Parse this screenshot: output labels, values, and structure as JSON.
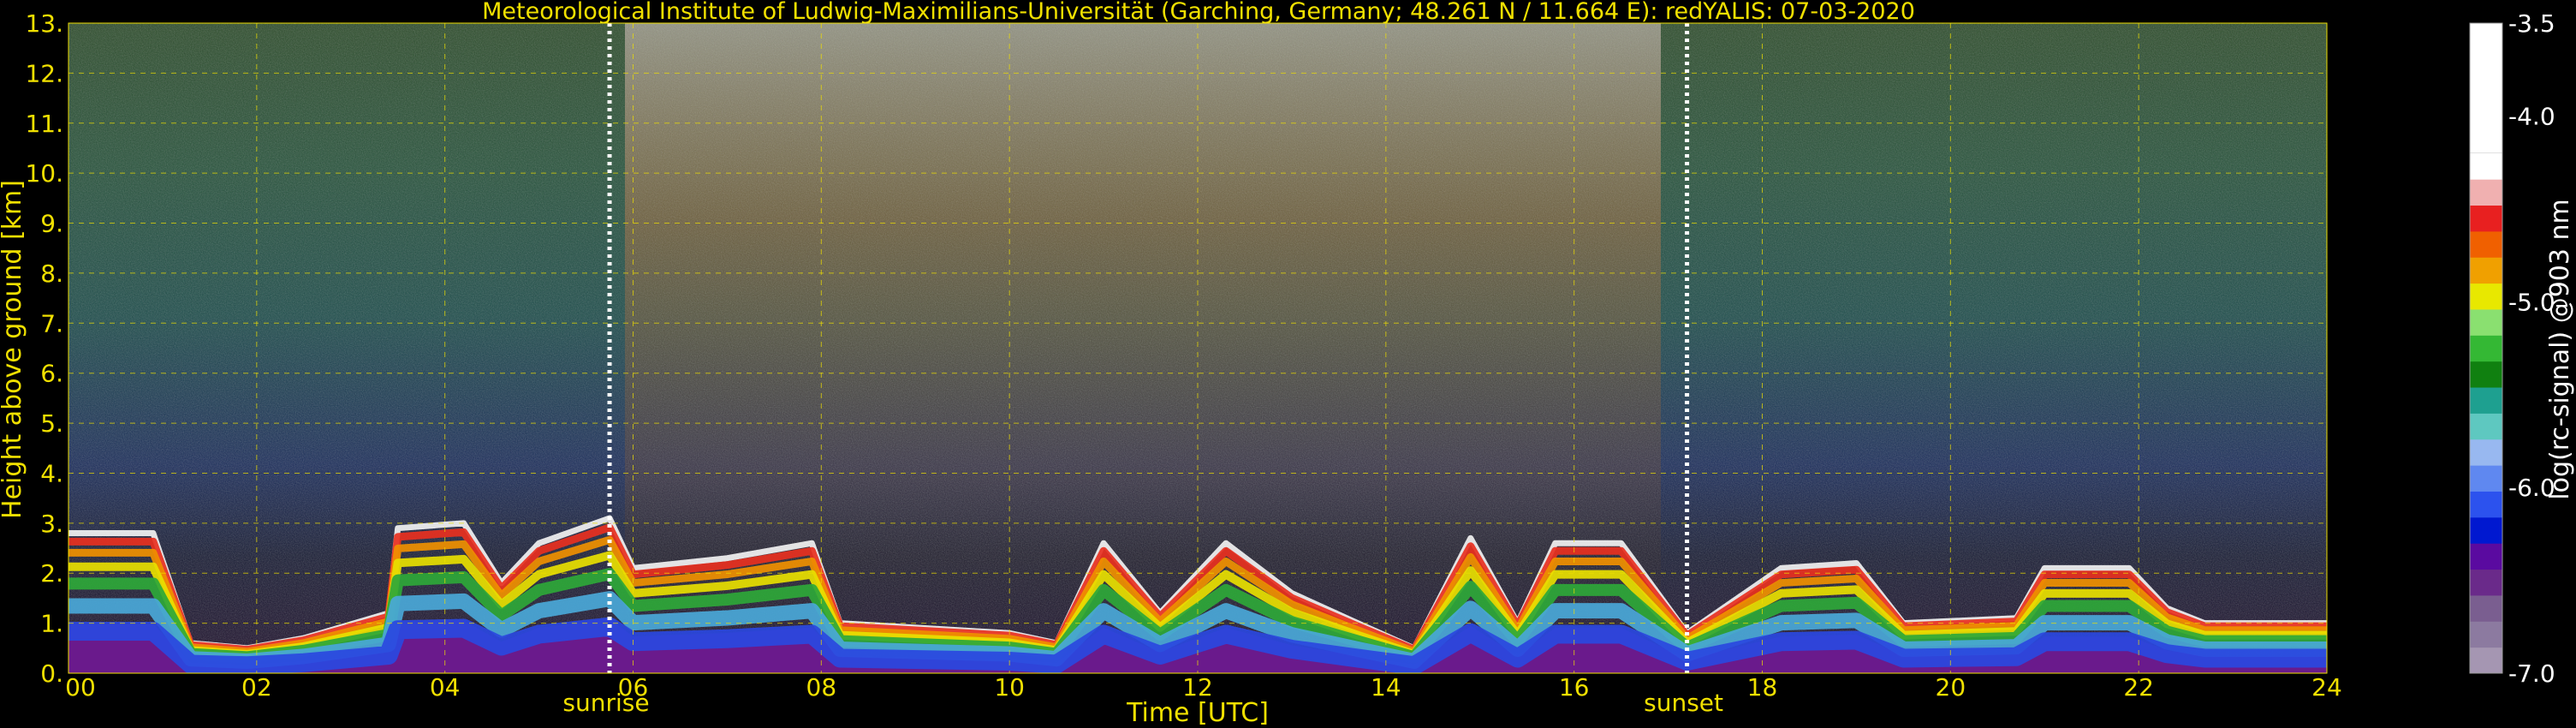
{
  "chart_data": {
    "type": "heatmap",
    "title": "Meteorological Institute of Ludwig-Maximilians-Universität (Garching, Germany; 48.261 N / 11.664 E):    redYALIS: 07-03-2020",
    "xlabel": "Time [UTC]",
    "ylabel": "Height above ground [km]",
    "xlim": [
      0,
      24
    ],
    "ylim": [
      0,
      13
    ],
    "xticks": [
      "00",
      "02",
      "04",
      "06",
      "08",
      "10",
      "12",
      "14",
      "16",
      "18",
      "20",
      "22",
      "24"
    ],
    "yticks": [
      "0.",
      "1.",
      "2.",
      "3.",
      "4.",
      "5.",
      "6.",
      "7.",
      "8.",
      "9.",
      "10.",
      "11.",
      "12.",
      "13."
    ],
    "grid": true,
    "events": [
      {
        "label": "sunrise",
        "time_utc": 5.75
      },
      {
        "label": "sunset",
        "time_utc": 17.2
      }
    ],
    "colorbar": {
      "label": "log(rc-signal) @903 nm",
      "range": [
        -7.0,
        -3.5
      ],
      "ticks": [
        "-3.5",
        "-4.0",
        "-5.0",
        "-6.0",
        "-7.0"
      ],
      "colors": [
        "#a596b2",
        "#8c7aa0",
        "#7a5e90",
        "#6a2a8a",
        "#5a0aa0",
        "#0018d0",
        "#2c52ee",
        "#5f88f0",
        "#98b8f0",
        "#5ec8c0",
        "#1ea090",
        "#108010",
        "#34b834",
        "#8ae070",
        "#e8e800",
        "#f0a000",
        "#f06000",
        "#e82020",
        "#f0b0b0",
        "#ffffff"
      ]
    },
    "profile_top_km": [
      [
        0.0,
        2.8
      ],
      [
        0.9,
        2.8
      ],
      [
        1.3,
        0.6
      ],
      [
        1.9,
        0.5
      ],
      [
        2.5,
        0.7
      ],
      [
        3.4,
        1.2
      ],
      [
        3.5,
        2.9
      ],
      [
        4.2,
        3.0
      ],
      [
        4.6,
        1.8
      ],
      [
        5.0,
        2.6
      ],
      [
        5.75,
        3.1
      ],
      [
        6.0,
        2.1
      ],
      [
        7.0,
        2.3
      ],
      [
        7.9,
        2.6
      ],
      [
        8.2,
        1.0
      ],
      [
        10.0,
        0.8
      ],
      [
        10.5,
        0.6
      ],
      [
        11.0,
        2.6
      ],
      [
        11.6,
        1.2
      ],
      [
        12.3,
        2.6
      ],
      [
        13.0,
        1.6
      ],
      [
        13.7,
        1.0
      ],
      [
        14.3,
        0.5
      ],
      [
        14.9,
        2.7
      ],
      [
        15.4,
        1.0
      ],
      [
        15.8,
        2.6
      ],
      [
        16.5,
        2.6
      ],
      [
        17.2,
        0.8
      ],
      [
        18.2,
        2.1
      ],
      [
        19.0,
        2.2
      ],
      [
        19.5,
        1.0
      ],
      [
        20.7,
        1.1
      ],
      [
        21.0,
        2.1
      ],
      [
        21.9,
        2.1
      ],
      [
        22.3,
        1.3
      ],
      [
        22.7,
        1.0
      ],
      [
        24.0,
        1.0
      ]
    ]
  }
}
